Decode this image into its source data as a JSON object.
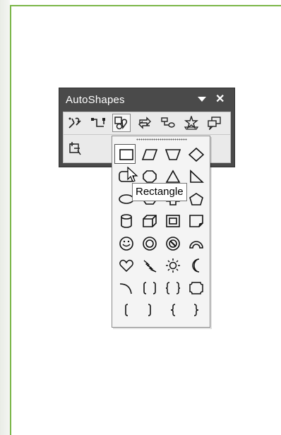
{
  "toolbar": {
    "title": "AutoShapes",
    "buttons_row1": [
      "lines-icon",
      "connectors-icon",
      "basic-shapes-icon",
      "block-arrows-icon",
      "flowchart-icon",
      "stars-and-banners-icon",
      "callouts-icon"
    ],
    "buttons_row2": [
      "more-autoshapes-icon"
    ],
    "active_button": "basic-shapes-icon"
  },
  "palette": {
    "selected_shape": "rectangle",
    "shapes": [
      "rectangle",
      "parallelogram",
      "trapezoid",
      "diamond",
      "rounded-rectangle",
      "octagon",
      "isosceles-triangle",
      "right-triangle",
      "oval",
      "hexagon",
      "cross",
      "pentagon",
      "can",
      "cube",
      "bevel",
      "folded-corner",
      "smiley-face",
      "donut",
      "no-symbol",
      "block-arc",
      "heart",
      "lightning-bolt",
      "sun",
      "moon",
      "arc",
      "double-bracket",
      "double-brace",
      "plaque",
      "left-bracket",
      "right-bracket",
      "left-brace",
      "right-brace"
    ]
  },
  "tooltip": {
    "text": "Rectangle"
  },
  "colors": {
    "toolbar": "#4a4a4a",
    "page_border": "#7ab648"
  }
}
